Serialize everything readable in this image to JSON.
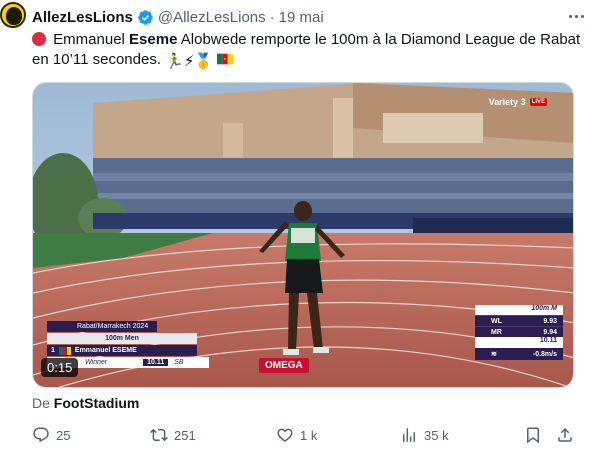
{
  "tweet": {
    "author_name": "AllezLesLions",
    "handle": "@AllezLesLions",
    "separator": "·",
    "date": "19 mai",
    "text_part1": " Emmanuel ",
    "text_bold": "Eseme",
    "text_part2": " Alobwede remporte le 100m à la Diamond League de Rabat en 10’11 secondes. ",
    "emojis": "🏃‍♂️⚡🥇",
    "source_prefix": "De ",
    "source_name": "FootStadium"
  },
  "video": {
    "timer": "0:15",
    "broadcaster": "Variety 3",
    "live_badge": "LIVE",
    "sponsor": "OMEGA",
    "overlay_left": {
      "venue": "Rabat/Marrakech 2024",
      "event": "100m Men",
      "position": "1",
      "athlete": "Emmanuel ESEME",
      "status": "Winner",
      "time": "10.11",
      "record": "SB"
    },
    "overlay_right": {
      "event": "100m M",
      "rows": [
        {
          "label": "WL",
          "value": "9.93"
        },
        {
          "label": "MR",
          "value": "9.94"
        }
      ],
      "result": "10.11",
      "wind": "-0.8m/s"
    }
  },
  "actions": {
    "replies": "25",
    "reposts": "251",
    "likes": "1 k",
    "views": "35 k"
  },
  "colors": {
    "text_primary": "#0f1419",
    "text_secondary": "#536471",
    "verified_blue": "#1d9bf0",
    "track_red": "#b55a4a",
    "overlay_purple": "#2b1d4f"
  }
}
